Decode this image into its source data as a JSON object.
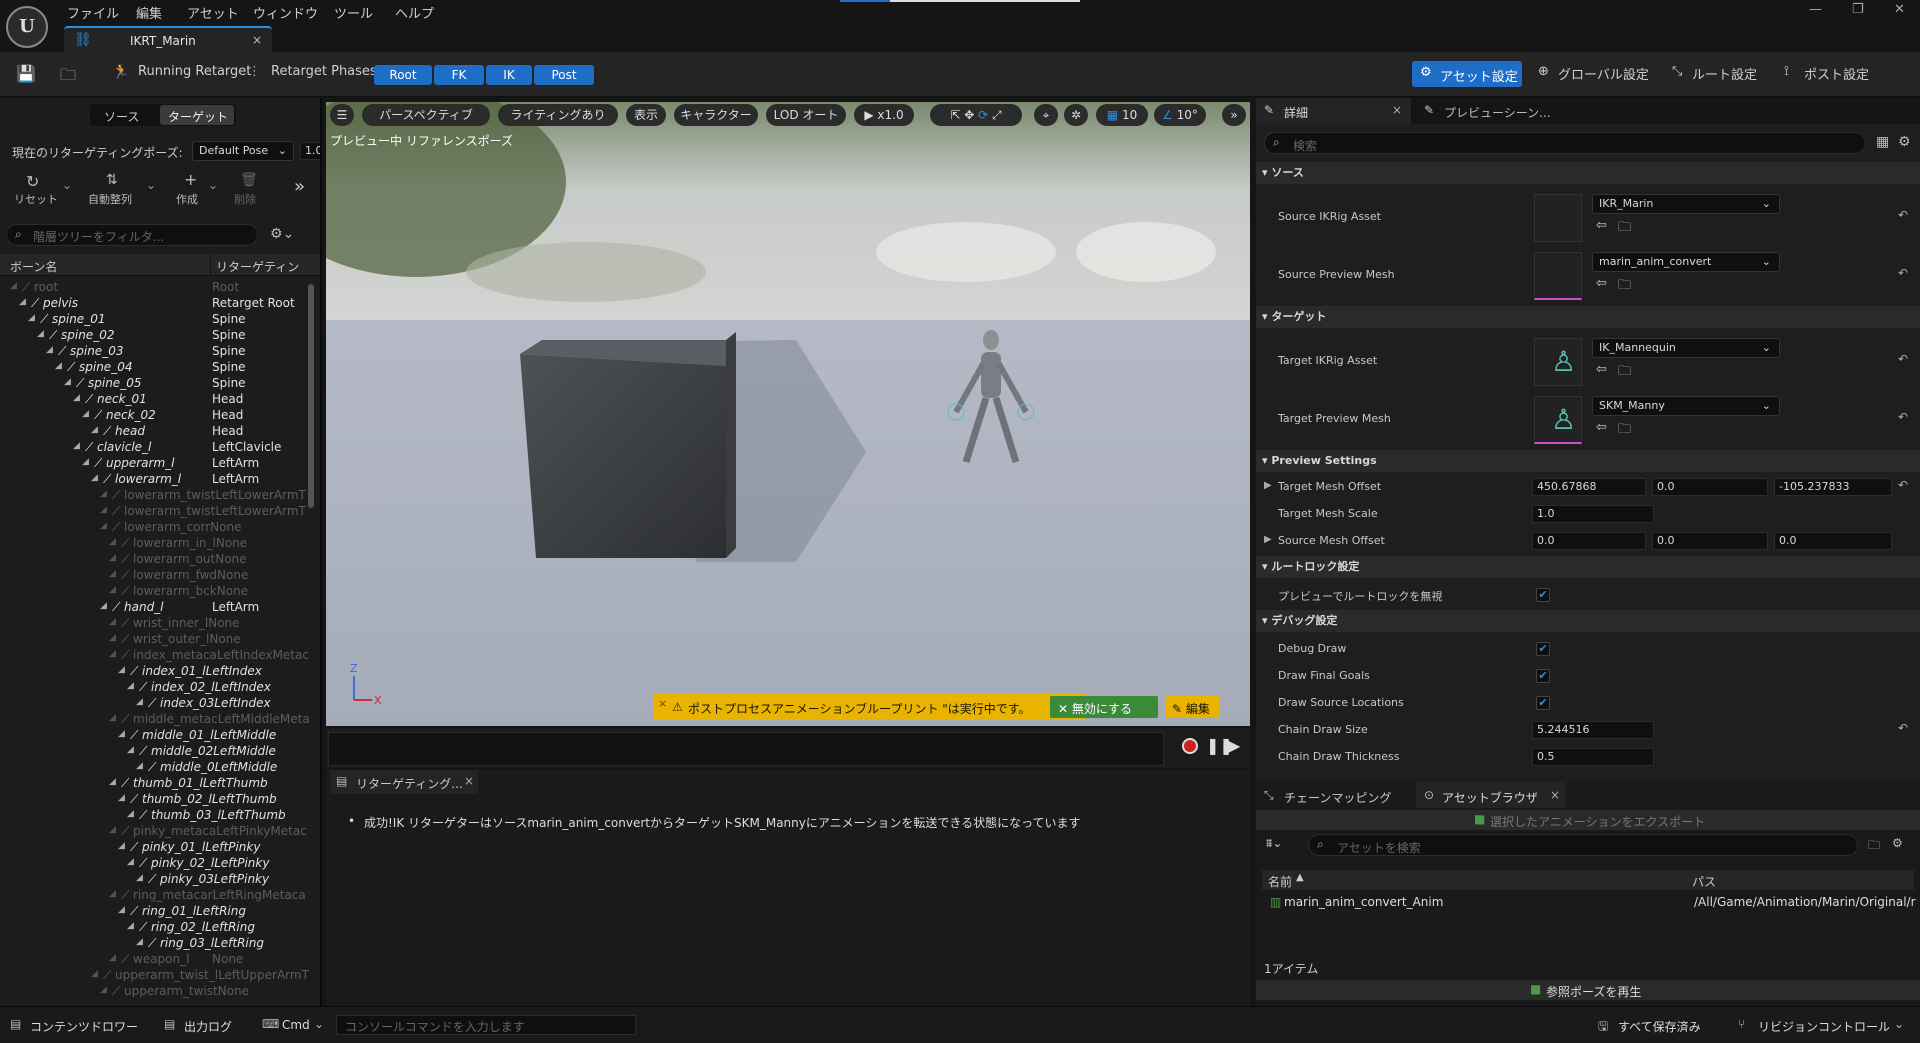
{
  "menu": [
    "ファイル",
    "編集",
    "アセット",
    "ウィンドウ",
    "ツール",
    "ヘルプ"
  ],
  "doc_tab": "IKRT_Marin",
  "toolbar": {
    "running_retarget": "Running Retarget",
    "retarget_phases_label": "Retarget Phases:",
    "phases": [
      "Root",
      "FK",
      "IK",
      "Post"
    ],
    "asset_settings": "アセット設定",
    "global_settings": "グローバル設定",
    "root_settings": "ルート設定",
    "post_settings": "ポスト設定"
  },
  "left": {
    "tab_source": "ソース",
    "tab_target": "ターゲット",
    "pose_label": "現在のリターゲティングポーズ:",
    "pose_value": "Default Pose",
    "pose_num": "1.0",
    "reset": "リセット",
    "auto_align": "自動整列",
    "create": "作成",
    "delete": "削除",
    "filter_placeholder": "階層ツリーをフィルタ...",
    "col_bone": "ボーン名",
    "col_retarget": "リターゲティン",
    "bones": [
      {
        "name": "root",
        "ret": "Root",
        "indent": 0,
        "bright": false
      },
      {
        "name": "pelvis",
        "ret": "Retarget Root",
        "indent": 1,
        "bright": true
      },
      {
        "name": "spine_01",
        "ret": "Spine",
        "indent": 2,
        "bright": true
      },
      {
        "name": "spine_02",
        "ret": "Spine",
        "indent": 3,
        "bright": true
      },
      {
        "name": "spine_03",
        "ret": "Spine",
        "indent": 4,
        "bright": true
      },
      {
        "name": "spine_04",
        "ret": "Spine",
        "indent": 5,
        "bright": true
      },
      {
        "name": "spine_05",
        "ret": "Spine",
        "indent": 6,
        "bright": true
      },
      {
        "name": "neck_01",
        "ret": "Head",
        "indent": 7,
        "bright": true
      },
      {
        "name": "neck_02",
        "ret": "Head",
        "indent": 8,
        "bright": true
      },
      {
        "name": "head",
        "ret": "Head",
        "indent": 9,
        "bright": true
      },
      {
        "name": "clavicle_l",
        "ret": "LeftClavicle",
        "indent": 7,
        "bright": true
      },
      {
        "name": "upperarm_l",
        "ret": "LeftArm",
        "indent": 8,
        "bright": true
      },
      {
        "name": "lowerarm_l",
        "ret": "LeftArm",
        "indent": 9,
        "bright": true
      },
      {
        "name": "lowerarm_twistLeftLowerArmT",
        "ret": "",
        "indent": 10,
        "bright": false
      },
      {
        "name": "lowerarm_twistLeftLowerArmT",
        "ret": "",
        "indent": 10,
        "bright": false
      },
      {
        "name": "lowerarm_corrNone",
        "ret": "",
        "indent": 10,
        "bright": false
      },
      {
        "name": "lowerarm_in_lNone",
        "ret": "",
        "indent": 11,
        "bright": false
      },
      {
        "name": "lowerarm_outNone",
        "ret": "",
        "indent": 11,
        "bright": false
      },
      {
        "name": "lowerarm_fwdNone",
        "ret": "",
        "indent": 11,
        "bright": false
      },
      {
        "name": "lowerarm_bckNone",
        "ret": "",
        "indent": 11,
        "bright": false
      },
      {
        "name": "hand_l",
        "ret": "LeftArm",
        "indent": 10,
        "bright": true
      },
      {
        "name": "wrist_inner_lNone",
        "ret": "",
        "indent": 11,
        "bright": false
      },
      {
        "name": "wrist_outer_lNone",
        "ret": "",
        "indent": 11,
        "bright": false
      },
      {
        "name": "index_metacaLeftIndexMetac",
        "ret": "",
        "indent": 11,
        "bright": false
      },
      {
        "name": "index_01_lLeftIndex",
        "ret": "",
        "indent": 12,
        "bright": true
      },
      {
        "name": "index_02_lLeftIndex",
        "ret": "",
        "indent": 13,
        "bright": true
      },
      {
        "name": "index_03LeftIndex",
        "ret": "",
        "indent": 14,
        "bright": true
      },
      {
        "name": "middle_metacLeftMiddleMeta",
        "ret": "",
        "indent": 11,
        "bright": false
      },
      {
        "name": "middle_01_lLeftMiddle",
        "ret": "",
        "indent": 12,
        "bright": true
      },
      {
        "name": "middle_02LeftMiddle",
        "ret": "",
        "indent": 13,
        "bright": true
      },
      {
        "name": "middle_0LeftMiddle",
        "ret": "",
        "indent": 14,
        "bright": true
      },
      {
        "name": "thumb_01_lLeftThumb",
        "ret": "",
        "indent": 11,
        "bright": true
      },
      {
        "name": "thumb_02_lLeftThumb",
        "ret": "",
        "indent": 12,
        "bright": true
      },
      {
        "name": "thumb_03_lLeftThumb",
        "ret": "",
        "indent": 13,
        "bright": true
      },
      {
        "name": "pinky_metacaLeftPinkyMetac",
        "ret": "",
        "indent": 11,
        "bright": false
      },
      {
        "name": "pinky_01_lLeftPinky",
        "ret": "",
        "indent": 12,
        "bright": true
      },
      {
        "name": "pinky_02_lLeftPinky",
        "ret": "",
        "indent": 13,
        "bright": true
      },
      {
        "name": "pinky_03LeftPinky",
        "ret": "",
        "indent": 14,
        "bright": true
      },
      {
        "name": "ring_metacarLeftRingMetaca",
        "ret": "",
        "indent": 11,
        "bright": false
      },
      {
        "name": "ring_01_lLeftRing",
        "ret": "",
        "indent": 12,
        "bright": true
      },
      {
        "name": "ring_02_lLeftRing",
        "ret": "",
        "indent": 13,
        "bright": true
      },
      {
        "name": "ring_03_lLeftRing",
        "ret": "",
        "indent": 14,
        "bright": true
      },
      {
        "name": "weapon_l",
        "ret": "None",
        "indent": 11,
        "bright": false
      },
      {
        "name": "upperarm_twist_lLeftUpperArmT",
        "ret": "",
        "indent": 9,
        "bright": false
      },
      {
        "name": "upperarm_twistNone",
        "ret": "",
        "indent": 10,
        "bright": false
      }
    ]
  },
  "viewport": {
    "perspective": "パースペクティブ",
    "lighting": "ライティングあり",
    "show": "表示",
    "character": "キャラクター",
    "lod": "LOD オート",
    "speed": "x1.0",
    "grid": "10",
    "angle": "10°",
    "preview_label": "プレビュー中 リファレンスポーズ",
    "warning": "ポストプロセスアニメーションブループリント \"は実行中です。",
    "disable_btn": "無効にする",
    "edit_btn": "編集"
  },
  "log": {
    "tab": "リターゲティング...",
    "message": "成功!IK リターゲターはソースmarin_anim_convertからターゲットSKM_Mannyにアニメーションを転送できる状態になっています"
  },
  "details": {
    "tab_details": "詳細",
    "tab_preview": "プレビューシーン...",
    "search_placeholder": "検索",
    "sect_source": "ソース",
    "source_ikrig_label": "Source IKRig Asset",
    "source_ikrig_value": "IKR_Marin",
    "source_mesh_label": "Source Preview Mesh",
    "source_mesh_value": "marin_anim_convert",
    "sect_target": "ターゲット",
    "target_ikrig_label": "Target IKRig Asset",
    "target_ikrig_value": "IK_Mannequin",
    "target_mesh_label": "Target Preview Mesh",
    "target_mesh_value": "SKM_Manny",
    "sect_preview": "Preview Settings",
    "target_offset_label": "Target Mesh Offset",
    "target_offset": [
      "450.67868",
      "0.0",
      "-105.237833"
    ],
    "target_scale_label": "Target Mesh Scale",
    "target_scale": "1.0",
    "source_offset_label": "Source Mesh Offset",
    "source_offset": [
      "0.0",
      "0.0",
      "0.0"
    ],
    "sect_rootlock": "ルートロック設定",
    "rootlock_label": "プレビューでルートロックを無視",
    "sect_debug": "デバッグ設定",
    "debug_draw": "Debug Draw",
    "draw_final_goals": "Draw Final Goals",
    "draw_source_locations": "Draw Source Locations",
    "chain_draw_size_label": "Chain Draw Size",
    "chain_draw_size": "5.244516",
    "chain_draw_thickness_label": "Chain Draw Thickness",
    "chain_draw_thickness": "0.5"
  },
  "assets": {
    "tab_chain": "チェーンマッピング",
    "tab_browser": "アセットブラウザ",
    "export_btn": "選択したアニメーションをエクスポート",
    "search_placeholder": "アセットを検索",
    "col_name": "名前",
    "col_path": "パス",
    "rows": [
      {
        "name": "marin_anim_convert_Anim",
        "path": "/All/Game/Animation/Marin/Original/r"
      }
    ],
    "count": "1アイテム",
    "play_ref": "参照ポーズを再生"
  },
  "bottom": {
    "content_drawer": "コンテンツドロワー",
    "output_log": "出力ログ",
    "cmd": "Cmd",
    "console_placeholder": "コンソールコマンドを入力します",
    "saved": "すべて保存済み",
    "revision": "リビジョンコントロール"
  },
  "colors": {
    "accent": "#1e6ec7",
    "warning": "#e8b400",
    "ok_green": "#3a8a3a"
  }
}
